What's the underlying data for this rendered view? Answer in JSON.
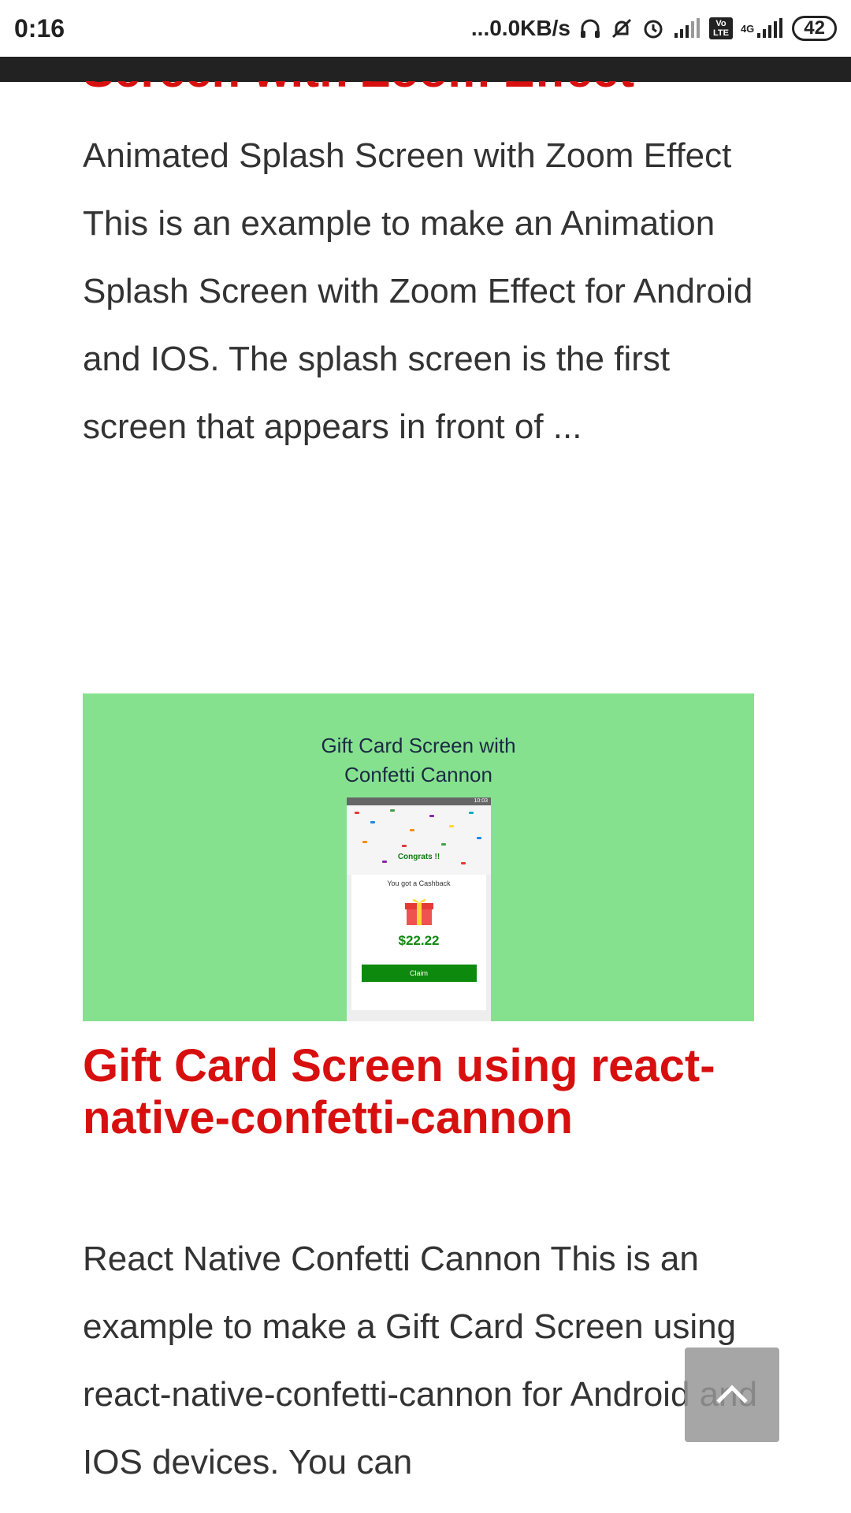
{
  "status_bar": {
    "time": "0:16",
    "speed": "...0.0KB/s",
    "volte": "Vo LTE",
    "net": "4G",
    "battery": "42"
  },
  "previous_article": {
    "title_fragment": "Screen with Zoom Effect",
    "excerpt": "Animated Splash Screen with Zoom Effect This is an example to make an Animation Splash Screen with Zoom Effect for Android and IOS. The splash screen is the first screen that appears in front of ..."
  },
  "article": {
    "image": {
      "title_line1": "Gift Card Screen with",
      "title_line2": "Confetti Cannon",
      "phone_status": "10:03",
      "congrats": "Congrats !!",
      "subtitle": "You got a Cashback",
      "amount": "$22.22",
      "claim": "Claim"
    },
    "title": "Gift Card Screen using react-native-confetti-cannon",
    "excerpt": "React Native Confetti Cannon This is an example to make a Gift Card Screen using react-native-confetti-cannon for Android and IOS devices. You can"
  },
  "colors": {
    "accent": "#d80f0f",
    "hero_bg": "#86e18f",
    "claim": "#0d8a0d"
  },
  "icons": [
    "headphones-icon",
    "bell-off-icon",
    "alarm-icon",
    "signal-icon",
    "chevron-up-icon"
  ]
}
